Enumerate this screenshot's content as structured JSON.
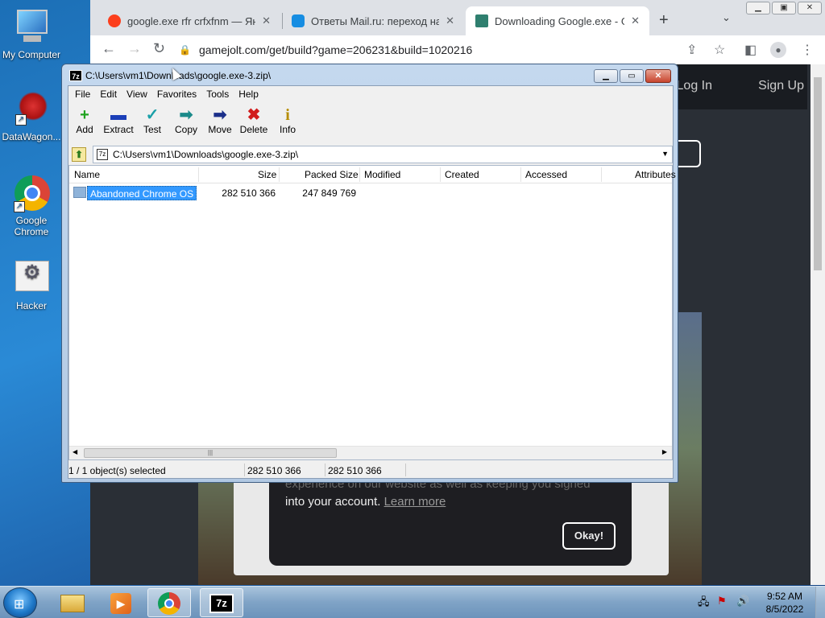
{
  "desktop": {
    "icons": [
      {
        "label": "My Computer"
      },
      {
        "label": "DataWagon..."
      },
      {
        "label": "Google Chrome"
      },
      {
        "label": "Hacker"
      }
    ]
  },
  "browser": {
    "tabs": [
      {
        "title": "google.exe rfr crfxfnm — Яндекс",
        "close": "✕"
      },
      {
        "title": "Ответы Mail.ru: переход на вэб",
        "close": "✕"
      },
      {
        "title": "Downloading Google.exe - Gam",
        "close": "✕"
      }
    ],
    "new_tab": "+",
    "tab_menu": "⌄",
    "url": "gamejolt.com/get/build?game=206231&build=1020216",
    "page": {
      "login": "Log In",
      "signup": "Sign Up",
      "download_button_partial": "w",
      "cookie_line1": "experience on our website as well as keeping you signed",
      "cookie_line2": "into your account.",
      "learn_more": "Learn more",
      "ok_button": "Okay!"
    }
  },
  "sevenzip": {
    "title": "C:\\Users\\vm1\\Downloads\\google.exe-3.zip\\",
    "menu": [
      "File",
      "Edit",
      "View",
      "Favorites",
      "Tools",
      "Help"
    ],
    "toolbar": [
      {
        "label": "Add",
        "icon": "+",
        "color": "#1fa31f"
      },
      {
        "label": "Extract",
        "icon": "▬",
        "color": "#1b3fb8"
      },
      {
        "label": "Test",
        "icon": "✓",
        "color": "#1aa0a8"
      },
      {
        "label": "Copy",
        "icon": "➡",
        "color": "#1a8a8a"
      },
      {
        "label": "Move",
        "icon": "➡",
        "color": "#1b2f8a"
      },
      {
        "label": "Delete",
        "icon": "✖",
        "color": "#d11c1c"
      },
      {
        "label": "Info",
        "icon": "i",
        "color": "#b58c00"
      }
    ],
    "address": "C:\\Users\\vm1\\Downloads\\google.exe-3.zip\\",
    "columns": [
      "Name",
      "Size",
      "Packed Size",
      "Modified",
      "Created",
      "Accessed",
      "Attributes"
    ],
    "rows": [
      {
        "name": "Abandoned Chrome OS",
        "size": "282 510 366",
        "packed": "247 849 769"
      }
    ],
    "status": {
      "selected": "1 / 1 object(s) selected",
      "size": "282 510 366",
      "packed": "282 510 366"
    }
  },
  "taskbar": {
    "time": "9:52 AM",
    "date": "8/5/2022"
  }
}
